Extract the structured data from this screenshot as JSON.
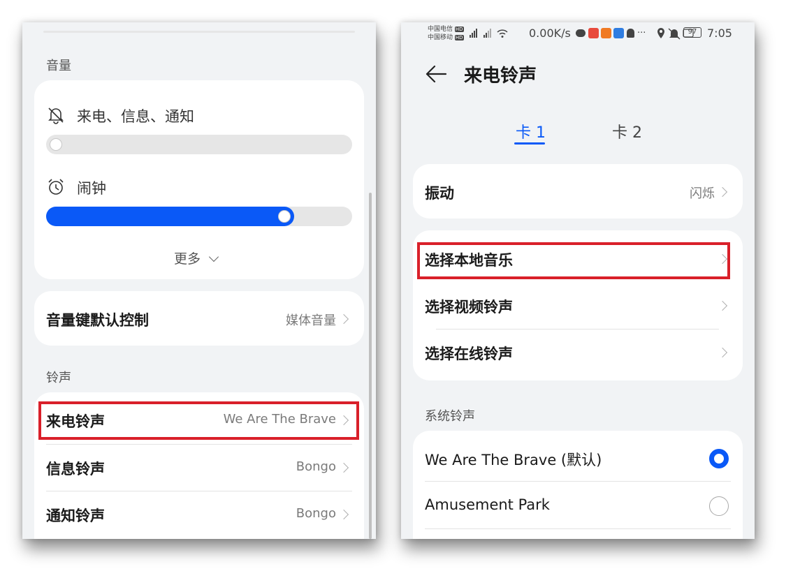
{
  "left": {
    "volume_section": "音量",
    "ring_notify_label": "来电、信息、通知",
    "ring_notify_level": 0.0,
    "alarm_label": "闹钟",
    "alarm_level": 0.81,
    "more_label": "更多",
    "volume_key": {
      "title": "音量键默认控制",
      "value": "媒体音量"
    },
    "ringtone_section": "铃声",
    "ringtone_rows": [
      {
        "title": "来电铃声",
        "value": "We Are The Brave"
      },
      {
        "title": "信息铃声",
        "value": "Bongo"
      },
      {
        "title": "通知铃声",
        "value": "Bongo"
      }
    ]
  },
  "right": {
    "status_bar": {
      "carrier1": "中国电信",
      "carrier2": "中国移动",
      "hd": "HD",
      "net_speed": "0.00K/s",
      "battery": "97",
      "time": "7:05"
    },
    "title": "来电铃声",
    "tabs": [
      {
        "label": "卡 1",
        "active": true
      },
      {
        "label": "卡 2",
        "active": false
      }
    ],
    "vibration": {
      "title": "振动",
      "value": "闪烁"
    },
    "options": [
      {
        "title": "选择本地音乐"
      },
      {
        "title": "选择视频铃声"
      },
      {
        "title": "选择在线铃声"
      }
    ],
    "system_section": "系统铃声",
    "system_ringtones": [
      {
        "name": "We Are The Brave (默认)",
        "selected": true
      },
      {
        "name": "Amusement Park",
        "selected": false
      }
    ]
  },
  "colors": {
    "accent": "#0a59f7",
    "highlight": "#d9202a",
    "background": "#f1f3f5"
  }
}
